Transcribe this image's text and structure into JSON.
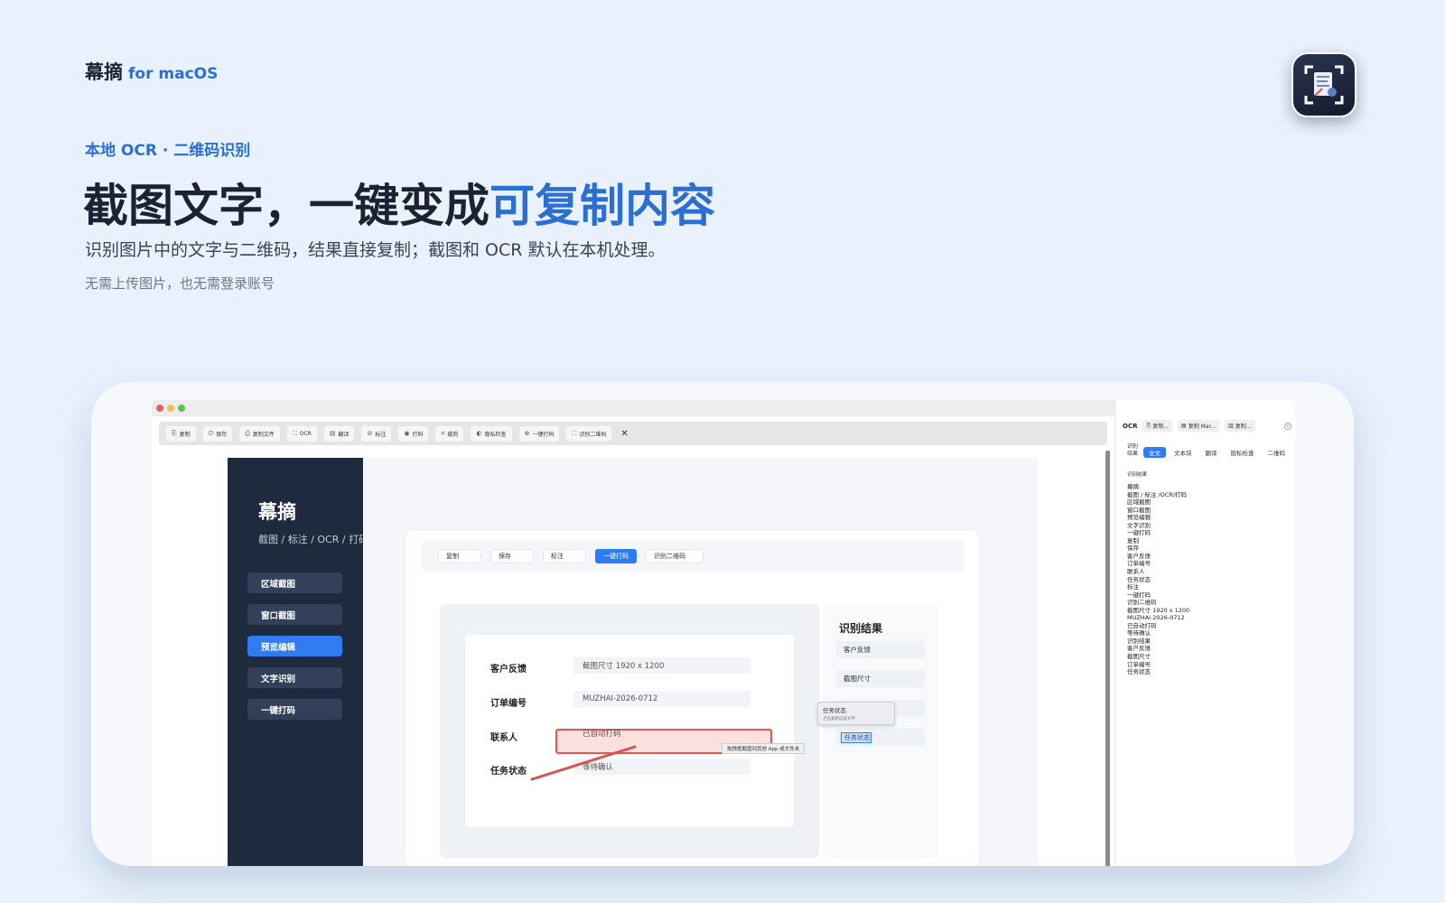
{
  "hero": {
    "brand_name": "幕摘",
    "brand_suffix": "for macOS",
    "eyebrow": "本地 OCR · 二维码识别",
    "headline_main": "截图文字，一键变成",
    "headline_accent": "可复制内容",
    "subline": "识别图片中的文字与二维码，结果直接复制；截图和 OCR 默认在本机处理。",
    "note": "无需上传图片，也无需登录账号"
  },
  "colors": {
    "accent": "#2b6fd1",
    "page_bg": "#e8f1fc",
    "dark_sidebar": "#1f2a3e",
    "active_button": "#2f7cf0",
    "highlight_red": "#e2574f"
  },
  "toolbar": {
    "buttons": [
      {
        "icon": "copy-icon",
        "label": "复制"
      },
      {
        "icon": "save-icon",
        "label": "保存"
      },
      {
        "icon": "copy-file-icon",
        "label": "复制文件"
      },
      {
        "icon": "ocr-icon",
        "label": "OCR"
      },
      {
        "icon": "translate-icon",
        "label": "翻译"
      },
      {
        "icon": "annotate-icon",
        "label": "标注"
      },
      {
        "icon": "eye-icon",
        "label": "打码"
      },
      {
        "icon": "crop-icon",
        "label": "裁剪"
      },
      {
        "icon": "privacy-icon",
        "label": "隐私检查"
      },
      {
        "icon": "mosaic-icon",
        "label": "一键打码"
      },
      {
        "icon": "qrcode-icon",
        "label": "识别二维码"
      }
    ],
    "close_glyph": "✕"
  },
  "preview": {
    "sidebar": {
      "title": "幕摘",
      "subtitle": "截图 / 标注 / OCR / 打码",
      "items": [
        {
          "label": "区域截图",
          "active": false
        },
        {
          "label": "窗口截图",
          "active": false
        },
        {
          "label": "预览编辑",
          "active": true
        },
        {
          "label": "文字识别",
          "active": false
        },
        {
          "label": "一键打码",
          "active": false
        }
      ]
    },
    "card_buttons": [
      {
        "label": "复制",
        "active": false
      },
      {
        "label": "保存",
        "active": false
      },
      {
        "label": "标注",
        "active": false
      },
      {
        "label": "一键打码",
        "active": true
      },
      {
        "label": "识别二维码",
        "active": false
      }
    ],
    "form": [
      {
        "label": "客户反馈",
        "value": "截图尺寸 1920 x 1200"
      },
      {
        "label": "订单编号",
        "value": "MUZHAI-2026-0712"
      },
      {
        "label": "联系人",
        "value": "已自动打码"
      },
      {
        "label": "任务状态",
        "value": "等待确认"
      }
    ],
    "drag_hint": "拖拽框截图到其他 App 或文件夹",
    "result_panel": {
      "title": "识别结果",
      "fields": [
        "客户反馈",
        "截图尺寸",
        "",
        ""
      ],
      "selected_chip": "任务状态"
    },
    "popup": {
      "title": "任务状态",
      "subtitle": "点击复制这段文字"
    }
  },
  "ocr_panel": {
    "label": "OCR",
    "header_buttons": [
      {
        "icon": "copy-icon",
        "label": "复制..."
      },
      {
        "icon": "markdown-icon",
        "label": "复制 Mar..."
      },
      {
        "icon": "table-icon",
        "label": "复制..."
      }
    ],
    "tabs_label": "识别结果",
    "tabs": [
      {
        "label": "全文",
        "active": true
      },
      {
        "label": "文本块",
        "active": false
      },
      {
        "label": "翻译",
        "active": false
      },
      {
        "label": "隐私检查",
        "active": false
      },
      {
        "label": "二维码",
        "active": false
      }
    ],
    "result_label": "识别结果",
    "lines": [
      "幕摘",
      "截图 / 标注 /OCR/打码",
      "区域截图",
      "窗口截图",
      "预览编辑",
      "文字识别",
      "一键打码",
      "复制",
      "保存",
      "客户反馈",
      "订单编号",
      "联系人",
      "任务状态",
      "标注",
      "一键打码",
      "识别二维码",
      "截图尺寸 1920 x 1200",
      "MUZHAI-2026-0712",
      "已自动打码",
      "等待确认",
      "识别结果",
      "客户反馈",
      "截图尺寸",
      "订单编号",
      "任务状态"
    ]
  }
}
